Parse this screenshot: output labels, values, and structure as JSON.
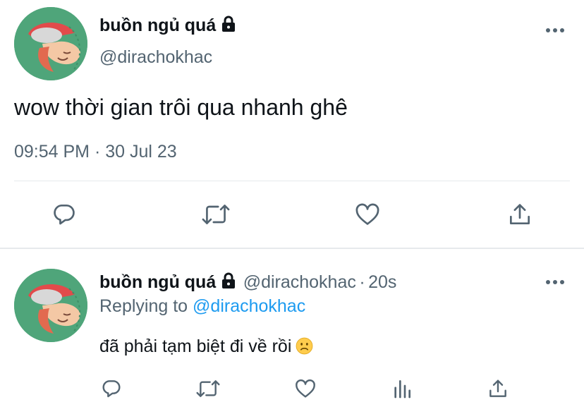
{
  "main_tweet": {
    "display_name": "buồn ngủ quá",
    "username": "@dirachokhac",
    "text": "wow thời gian trôi qua nhanh ghê",
    "time": "09:54 PM",
    "separator": "·",
    "date": "30 Jul 23",
    "icons": [
      "lock-icon",
      "more-icon",
      "reply-icon",
      "retweet-icon",
      "like-icon",
      "share-icon"
    ]
  },
  "reply_tweet": {
    "display_name": "buồn ngủ quá",
    "username": "@dirachokhac",
    "separator": "·",
    "age": "20s",
    "replying_prefix": "Replying to",
    "replying_to": "@dirachokhac",
    "text": "đã phải tạm biệt đi về rồi",
    "emoji": "slightly-frowning-face",
    "icons": [
      "lock-icon",
      "more-icon",
      "reply-icon",
      "retweet-icon",
      "like-icon",
      "analytics-icon",
      "share-icon"
    ]
  },
  "colors": {
    "text_primary": "#0f1419",
    "text_secondary": "#536471",
    "link": "#1d9bf0",
    "divider": "#e6e9ec",
    "avatar_bg": "#4fa57a"
  }
}
